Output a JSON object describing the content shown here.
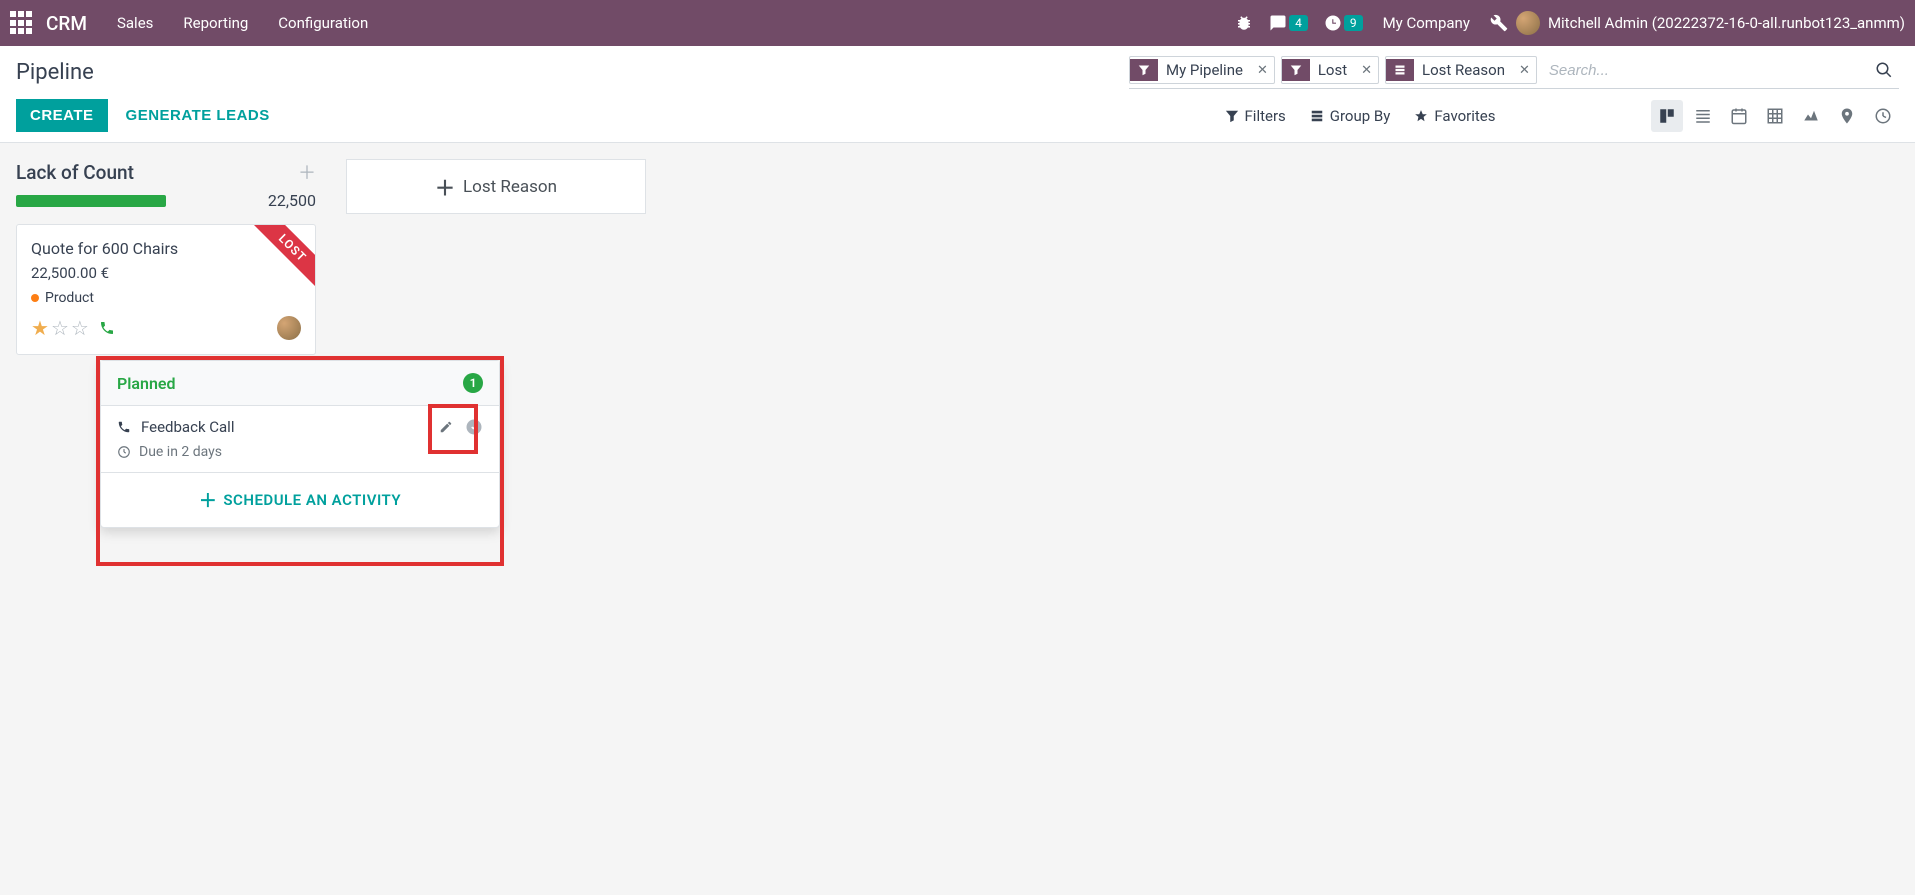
{
  "topbar": {
    "app": "CRM",
    "nav": [
      "Sales",
      "Reporting",
      "Configuration"
    ],
    "msg_count": "4",
    "act_count": "9",
    "company": "My Company",
    "user": "Mitchell Admin (20222372-16-0-all.runbot123_anmm)"
  },
  "breadcrumb": "Pipeline",
  "buttons": {
    "create": "CREATE",
    "generate": "GENERATE LEADS"
  },
  "facets": [
    {
      "type": "filter",
      "label": "My Pipeline"
    },
    {
      "type": "filter",
      "label": "Lost"
    },
    {
      "type": "groupby",
      "label": "Lost Reason"
    }
  ],
  "search_placeholder": "Search...",
  "search_options": {
    "filters": "Filters",
    "groupby": "Group By",
    "favorites": "Favorites"
  },
  "column": {
    "title": "Lack of Count",
    "total": "22,500"
  },
  "add_column": "Lost Reason",
  "card": {
    "title": "Quote for 600 Chairs",
    "amount": "22,500.00 €",
    "tag": "Product",
    "ribbon": "LOST",
    "stars_on": 1,
    "stars_total": 3
  },
  "popover": {
    "status": "Planned",
    "count": "1",
    "activity_name": "Feedback Call",
    "due": "Due in 2 days",
    "schedule": "SCHEDULE AN ACTIVITY"
  }
}
